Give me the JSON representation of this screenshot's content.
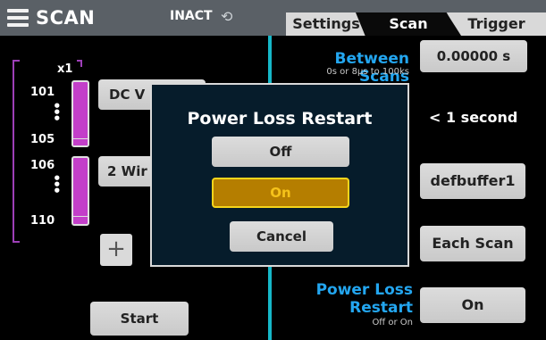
{
  "header": {
    "title": "SCAN",
    "status": "INACT",
    "status_icon": "sync-icon"
  },
  "tabs": [
    {
      "label": "Settings",
      "active": false
    },
    {
      "label": "Scan",
      "active": true
    },
    {
      "label": "Trigger",
      "active": false
    }
  ],
  "scan_list": {
    "count_label": "x1",
    "groups": [
      {
        "start": "101",
        "end": "105",
        "function": "DC V"
      },
      {
        "start": "106",
        "end": "110",
        "function": "2 Wir"
      }
    ],
    "start_label": "Start"
  },
  "settings": {
    "between_scans": {
      "label": "Between Scans",
      "range": "0s or 8µs to 100ks",
      "value": "0.00000 s"
    },
    "time_value": "< 1 second",
    "buffer": "defbuffer1",
    "write_mode": "Each Scan",
    "power_loss": {
      "label_line1": "Power Loss",
      "label_line2": "Restart",
      "range": "Off or On",
      "value": "On"
    }
  },
  "dialog": {
    "title": "Power Loss Restart",
    "options": [
      {
        "label": "Off",
        "selected": false
      },
      {
        "label": "On",
        "selected": true
      }
    ],
    "cancel_label": "Cancel"
  },
  "colors": {
    "accent": "#16b7c8",
    "label_blue": "#23a6f0",
    "channel_bar": "#c33fc9",
    "selected_border": "#f5d51b"
  }
}
